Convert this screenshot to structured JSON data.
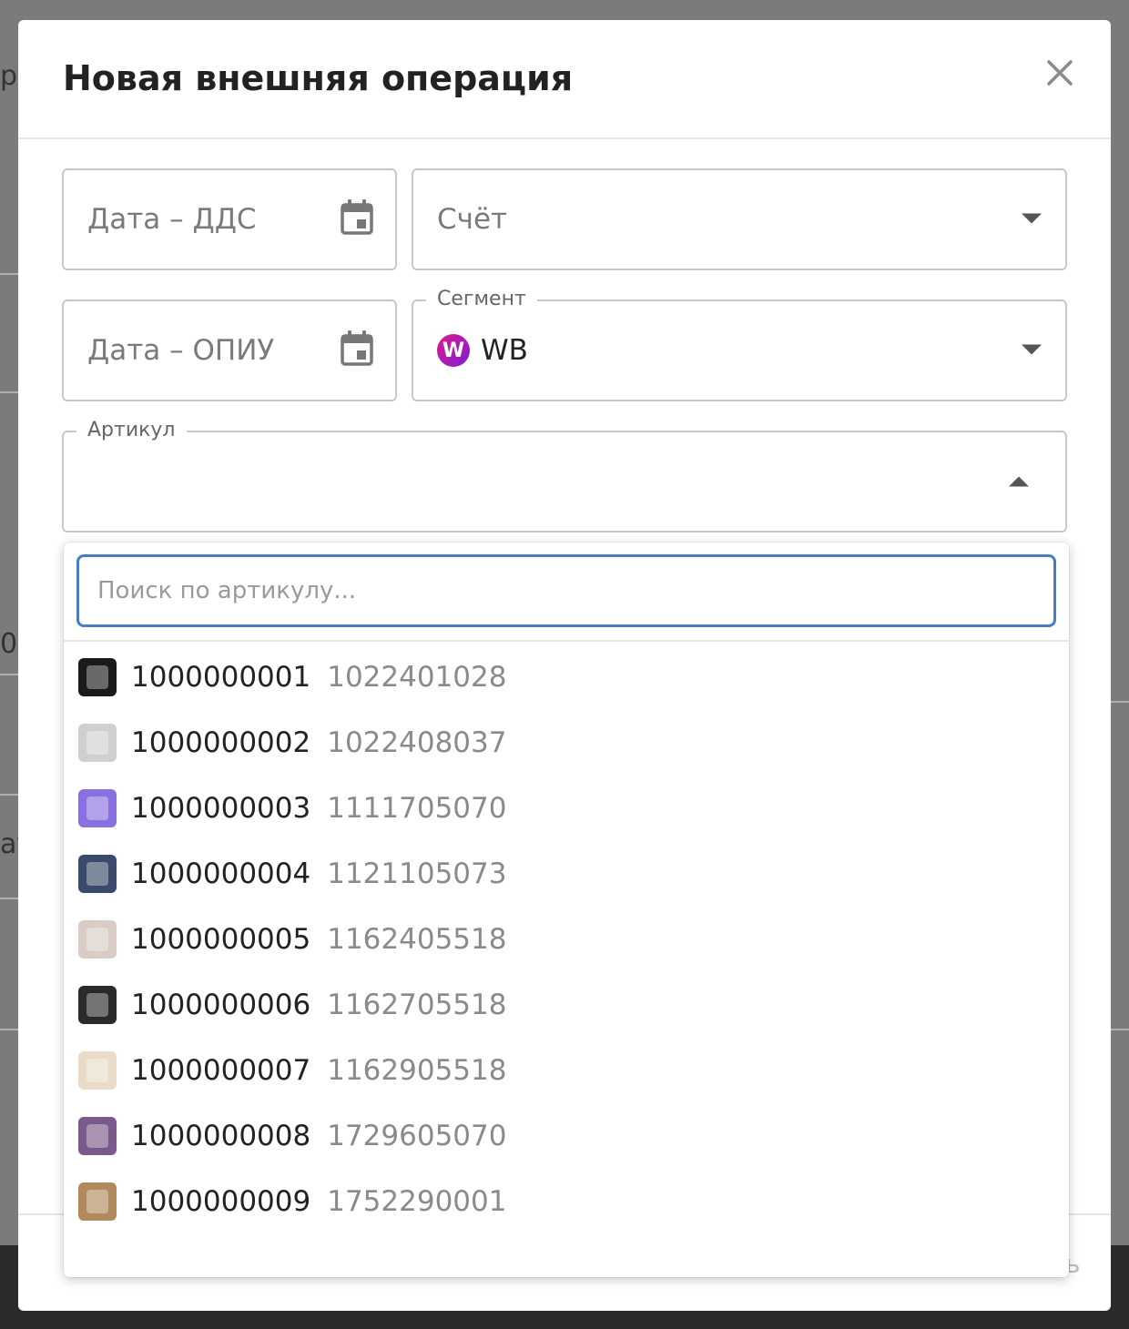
{
  "modal": {
    "title": "Новая внешняя операция"
  },
  "fields": {
    "date_dds": {
      "placeholder": "Дата – ДДС"
    },
    "account": {
      "placeholder": "Счёт"
    },
    "date_opiu": {
      "placeholder": "Дата – ОПИУ"
    },
    "segment": {
      "label": "Сегмент",
      "value": "WB",
      "logo_text": "W"
    },
    "article": {
      "label": "Артикул"
    }
  },
  "dropdown": {
    "search_placeholder": "Поиск по артикулу...",
    "options": [
      {
        "id": "1000000001",
        "sub": "1022401028",
        "thumb_color": "#1a1a1a"
      },
      {
        "id": "1000000002",
        "sub": "1022408037",
        "thumb_color": "#cfcfcf"
      },
      {
        "id": "1000000003",
        "sub": "1111705070",
        "thumb_color": "#8a6fe0"
      },
      {
        "id": "1000000004",
        "sub": "1121105073",
        "thumb_color": "#3a4a6a"
      },
      {
        "id": "1000000005",
        "sub": "1162405518",
        "thumb_color": "#d8ccc4"
      },
      {
        "id": "1000000006",
        "sub": "1162705518",
        "thumb_color": "#2a2a2a"
      },
      {
        "id": "1000000007",
        "sub": "1162905518",
        "thumb_color": "#e8dcc8"
      },
      {
        "id": "1000000008",
        "sub": "1729605070",
        "thumb_color": "#7a5a8a"
      },
      {
        "id": "1000000009",
        "sub": "1752290001",
        "thumb_color": "#b08a5a"
      }
    ]
  },
  "colors": {
    "accent": "#4a7bc8",
    "wb_logo_start": "#e0188a",
    "wb_logo_end": "#7b1fd6"
  }
}
